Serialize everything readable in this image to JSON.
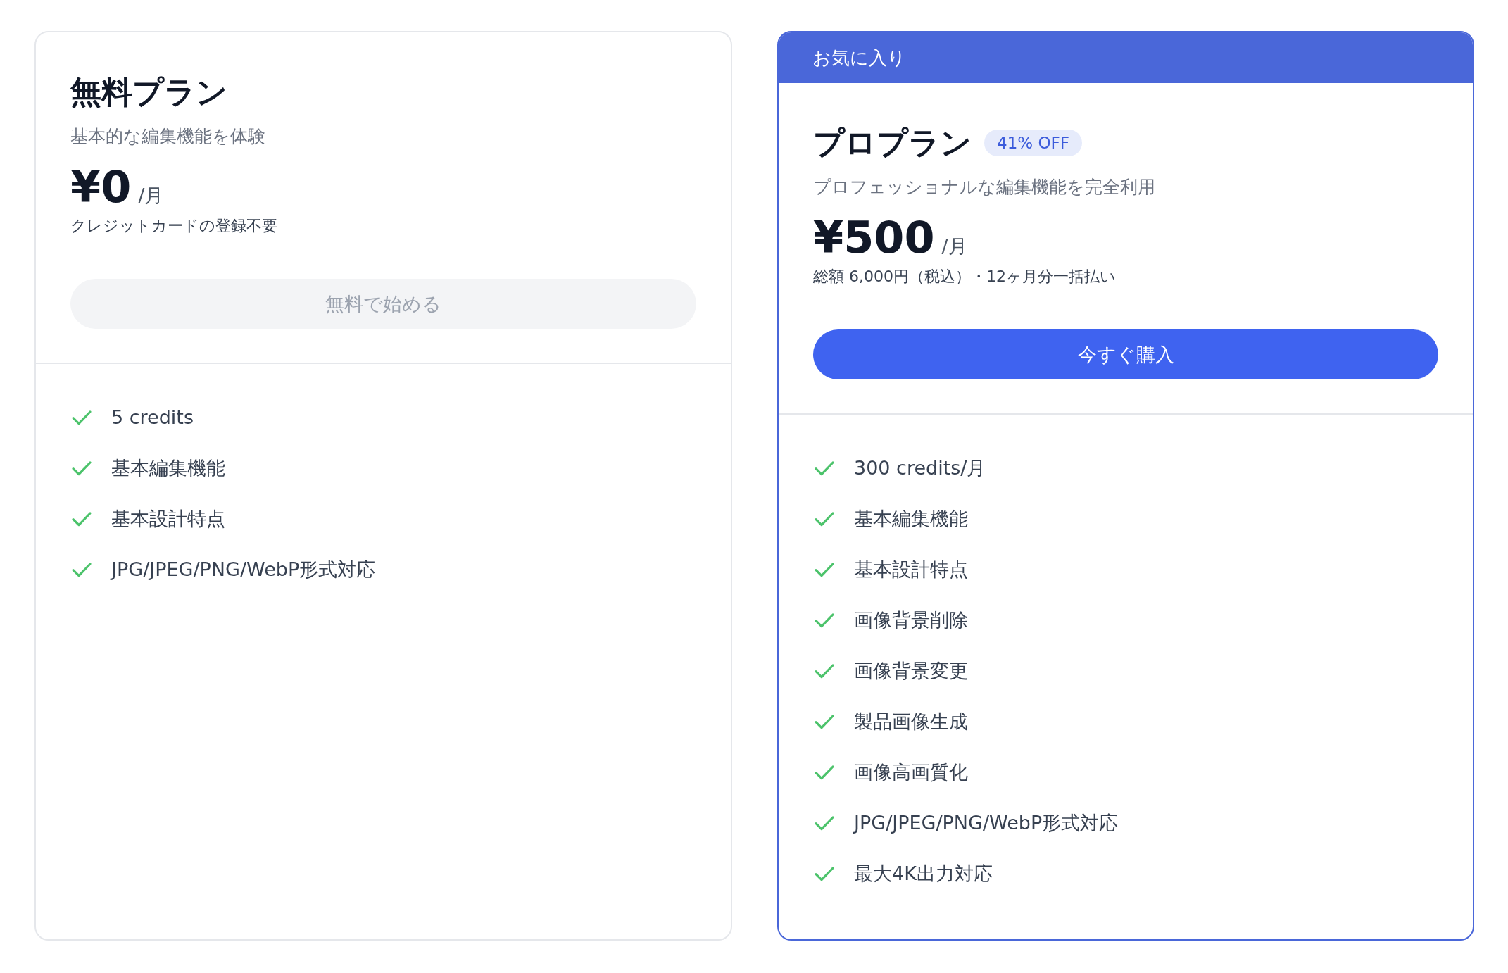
{
  "plans": [
    {
      "name": "無料プラン",
      "description": "基本的な編集機能を体験",
      "price": "¥0",
      "period": "/月",
      "note": "クレジットカードの登録不要",
      "button": {
        "label": "無料で始める",
        "disabled": true
      },
      "featured": false,
      "features": [
        "5 credits",
        "基本編集機能",
        "基本設計特点",
        "JPG/JPEG/PNG/WebP形式対応"
      ]
    },
    {
      "ribbon": "お気に入り",
      "name": "プロプラン",
      "discount": "41% OFF",
      "description": "プロフェッショナルな編集機能を完全利用",
      "price": "¥500",
      "period": "/月",
      "note": "総額 6,000円（税込）・12ヶ月分一括払い",
      "button": {
        "label": "今すぐ購入",
        "disabled": false
      },
      "featured": true,
      "features": [
        "300 credits/月",
        "基本編集機能",
        "基本設計特点",
        "画像背景削除",
        "画像背景変更",
        "製品画像生成",
        "画像高画質化",
        "JPG/JPEG/PNG/WebP形式対応",
        "最大4K出力対応"
      ]
    }
  ]
}
